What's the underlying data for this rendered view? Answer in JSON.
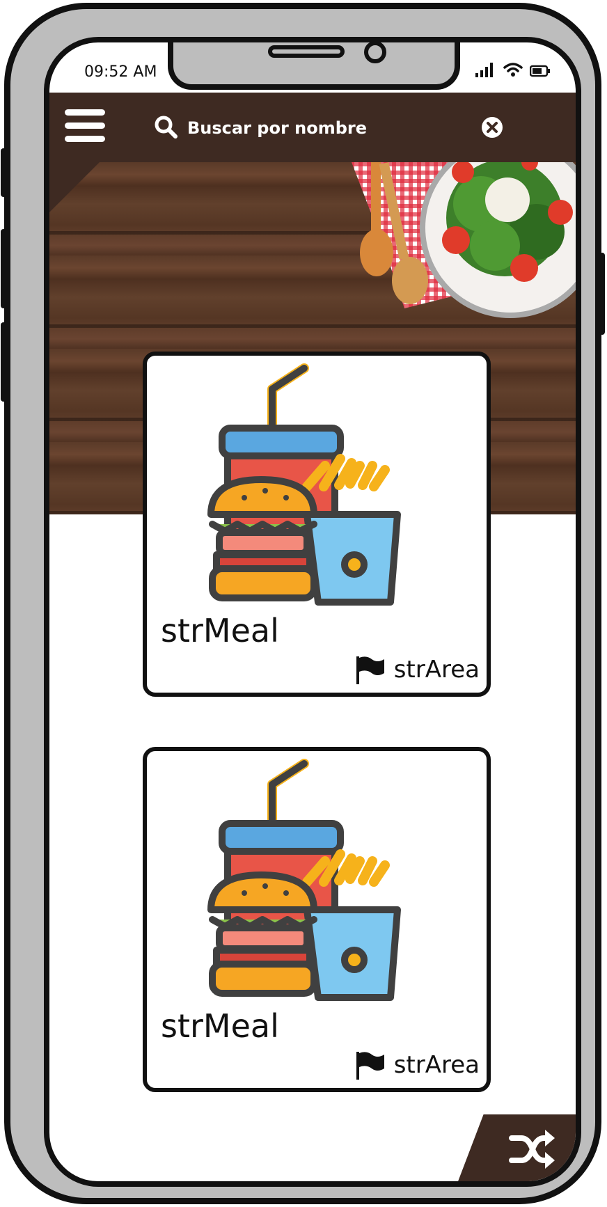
{
  "status_bar": {
    "time": "09:52 AM",
    "icons": [
      "signal-icon",
      "wifi-icon",
      "battery-icon"
    ]
  },
  "header": {
    "menu_icon": "hamburger-menu-icon",
    "search_icon": "search-icon",
    "search_placeholder": "Buscar por nombre",
    "clear_icon": "close-circle-icon"
  },
  "meals": [
    {
      "title": "strMeal",
      "area": "strArea",
      "image": "fast-food-illustration",
      "area_icon": "flag-icon"
    },
    {
      "title": "strMeal",
      "area": "strArea",
      "image": "fast-food-illustration",
      "area_icon": "flag-icon"
    }
  ],
  "fab": {
    "icon": "shuffle-icon"
  },
  "colors": {
    "brand": "#3e2a22",
    "frame": "#bdbdbd",
    "ink": "#111111"
  }
}
